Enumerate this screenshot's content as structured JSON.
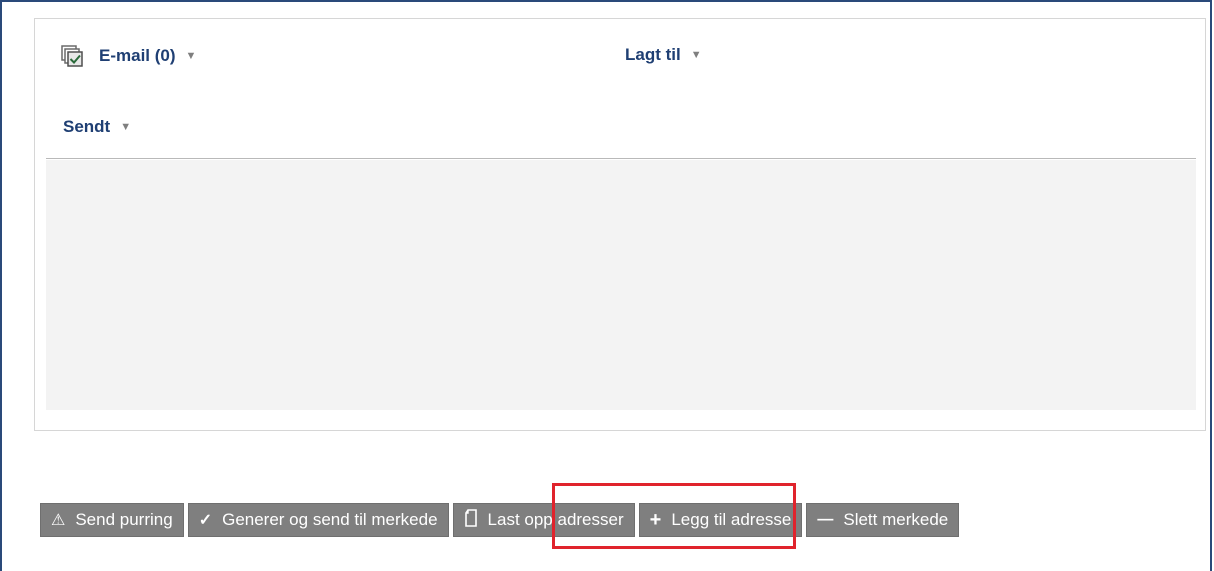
{
  "table": {
    "columns": {
      "email": "E-mail (0)",
      "added": "Lagt til",
      "sent": "Sendt"
    },
    "sort_caret": "▼",
    "select_all_icon": "select-all-checkbox-icon",
    "rows": []
  },
  "toolbar": {
    "buttons": [
      {
        "icon": "⚠",
        "icon_name": "warning-icon",
        "label": "Send purring"
      },
      {
        "icon": "✓",
        "icon_name": "checkmark-icon",
        "label": "Generer og send til merkede"
      },
      {
        "icon": "▯",
        "icon_name": "document-icon",
        "label": "Last opp adresser"
      },
      {
        "icon": "+",
        "icon_name": "plus-icon",
        "label": "Legg til adresse"
      },
      {
        "icon": "—",
        "icon_name": "minus-icon",
        "label": "Slett merkede"
      }
    ]
  },
  "colors": {
    "header_text": "#1f3f73",
    "button_bg": "#7f7f7f",
    "highlight": "#e0232c",
    "empty_bg": "#f3f3f3"
  }
}
